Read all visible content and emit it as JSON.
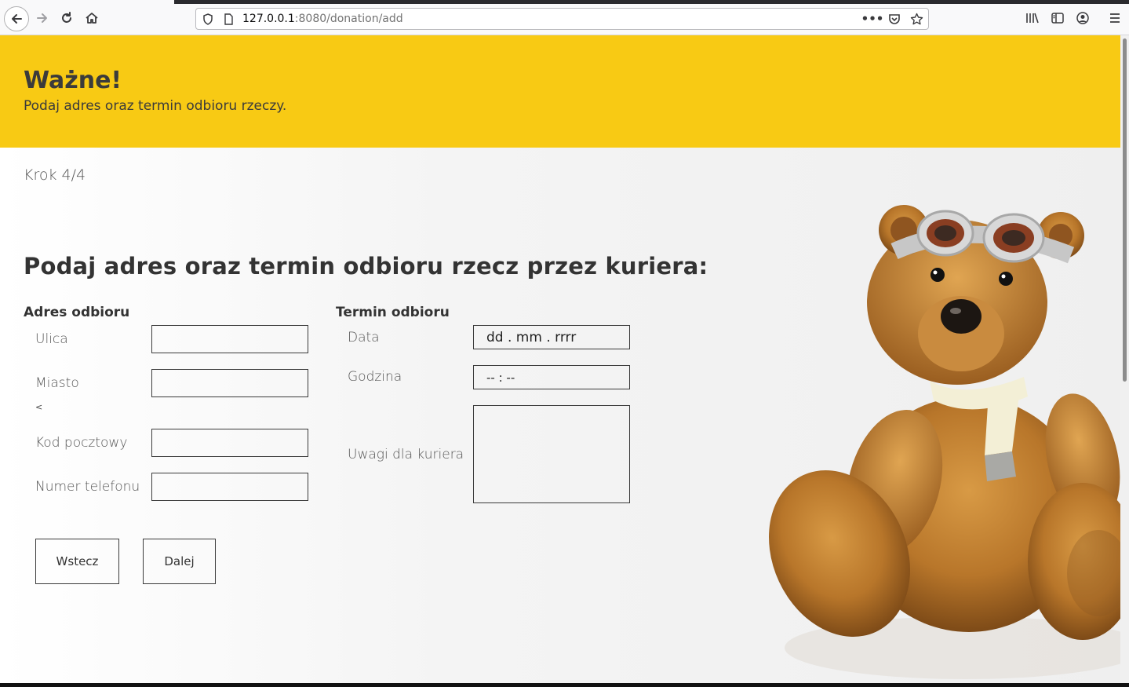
{
  "browser": {
    "url_host": "127.0.0.1",
    "url_rest": ":8080/donation/add"
  },
  "banner": {
    "title": "Ważne!",
    "subtitle": "Podaj adres oraz termin odbioru rzeczy."
  },
  "step": "Krok 4/4",
  "heading": "Podaj adres oraz termin odbioru rzecz przez kuriera:",
  "address": {
    "title": "Adres odbioru",
    "street_label": "Ulica",
    "city_label": "Miasto",
    "stray_char": "<",
    "postcode_label": "Kod pocztowy",
    "phone_label": "Numer telefonu"
  },
  "pickup": {
    "title": "Termin odbioru",
    "date_label": "Data",
    "date_placeholder": "dd . mm . rrrr",
    "time_label": "Godzina",
    "time_placeholder": "-- : --",
    "notes_label": "Uwagi dla kuriera"
  },
  "buttons": {
    "back": "Wstecz",
    "next": "Dalej"
  },
  "colors": {
    "banner": "#f8ca14",
    "text": "#333333"
  }
}
